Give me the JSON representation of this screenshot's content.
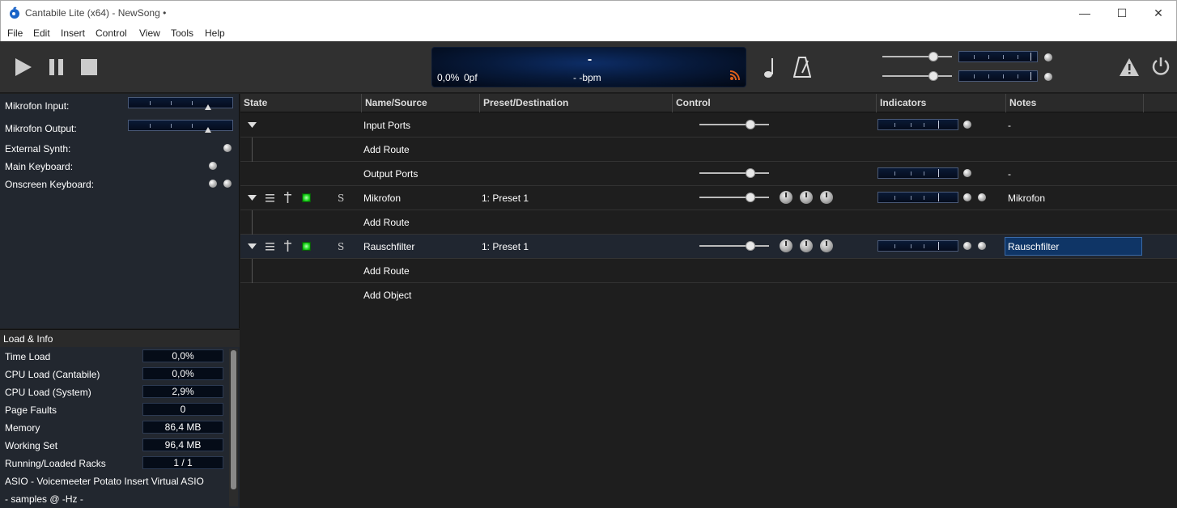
{
  "window": {
    "title": "Cantabile Lite (x64) - NewSong •",
    "controls": {
      "minimize": "—",
      "maximize": "☐",
      "close": "✕"
    }
  },
  "menu": [
    "File",
    "Edit",
    "Insert",
    "Control",
    "View",
    "Tools",
    "Help"
  ],
  "toolbar": {
    "icons": [
      "play-icon",
      "pause-icon",
      "stop-icon",
      "note-icon",
      "metronome-icon",
      "warning-icon",
      "power-icon"
    ],
    "display": {
      "main": "-",
      "load": "0,0%",
      "faults": "0pf",
      "tempo": "- -bpm"
    }
  },
  "left_panel": {
    "ports": [
      {
        "label": "Mikrofon Input:",
        "type": "meter"
      },
      {
        "label": "Mikrofon Output:",
        "type": "meter"
      },
      {
        "label": "External Synth:",
        "type": "led"
      },
      {
        "label": "Main Keyboard:",
        "type": "led"
      },
      {
        "label": "Onscreen Keyboard:",
        "type": "led2"
      }
    ]
  },
  "load_info": {
    "title": "Load & Info",
    "rows": [
      {
        "label": "Time Load",
        "value": "0,0%"
      },
      {
        "label": "CPU Load (Cantabile)",
        "value": "0,0%"
      },
      {
        "label": "CPU Load (System)",
        "value": "2,9%"
      },
      {
        "label": "Page Faults",
        "value": "0"
      },
      {
        "label": "Memory",
        "value": "86,4 MB"
      },
      {
        "label": "Working Set",
        "value": "96,4 MB"
      },
      {
        "label": "Running/Loaded Racks",
        "value": "1 / 1"
      }
    ],
    "driver": "ASIO - Voicemeeter Potato Insert Virtual ASIO",
    "samples": "- samples @ -Hz -"
  },
  "columns": [
    "State",
    "Name/Source",
    "Preset/Destination",
    "Control",
    "Indicators",
    "Notes"
  ],
  "rows": [
    {
      "name": "Input Ports",
      "preset": "",
      "note": "-",
      "kind": "port"
    },
    {
      "name": "Add Route",
      "preset": "",
      "note": "",
      "kind": "add"
    },
    {
      "name": "Output Ports",
      "preset": "",
      "note": "-",
      "kind": "port"
    },
    {
      "name": "Mikrofon",
      "preset": "1: Preset 1",
      "note": "Mikrofon",
      "kind": "plugin",
      "solo": "S"
    },
    {
      "name": "Add Route",
      "preset": "",
      "note": "",
      "kind": "add"
    },
    {
      "name": "Rauschfilter",
      "preset": "1: Preset 1",
      "note": "Rauschfilter",
      "kind": "plugin",
      "solo": "S"
    },
    {
      "name": "Add Route",
      "preset": "",
      "note": "",
      "kind": "add"
    },
    {
      "name": "Add Object",
      "preset": "",
      "note": "",
      "kind": "object"
    }
  ],
  "colors": {
    "accent": "#0f3566",
    "display_bg": "#071a3c",
    "led_green": "#19d419",
    "rss": "#e0601a"
  }
}
